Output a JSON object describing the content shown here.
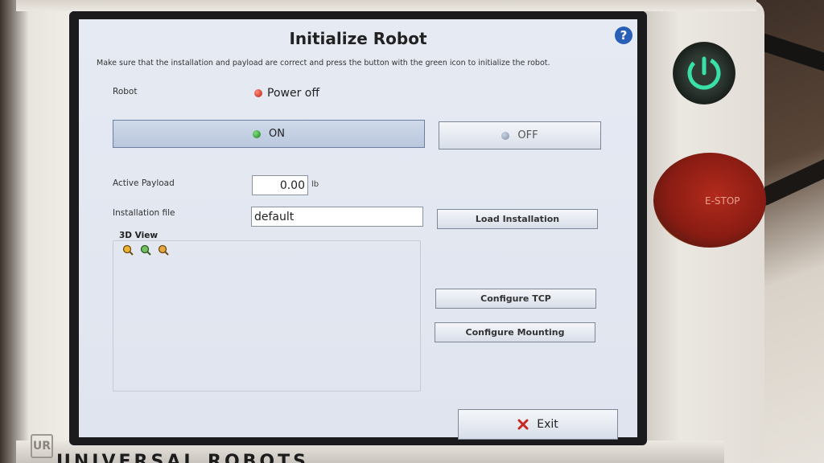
{
  "screen": {
    "title": "Initialize Robot",
    "help_label": "?",
    "subtitle": "Make sure that the installation and payload are correct and press the button with the green icon to initialize the robot.",
    "robot_label": "Robot",
    "robot_status": "Power off",
    "on_label": "ON",
    "off_label": "OFF",
    "payload_label": "Active Payload",
    "payload_value": "0.00",
    "payload_unit": "lb",
    "installation_label": "Installation file",
    "installation_value": "default",
    "load_installation_label": "Load Installation",
    "view_label": "3D View",
    "configure_tcp_label": "Configure TCP",
    "configure_mounting_label": "Configure Mounting",
    "exit_label": "Exit"
  },
  "hardware": {
    "estop_label": "E-STOP",
    "brand_text": "UNIVERSAL ROBOTS",
    "logo_text": "UR"
  },
  "colors": {
    "power_glow": "#39e0a8",
    "help_blue": "#2a5fb8",
    "exit_red": "#c8281e"
  }
}
